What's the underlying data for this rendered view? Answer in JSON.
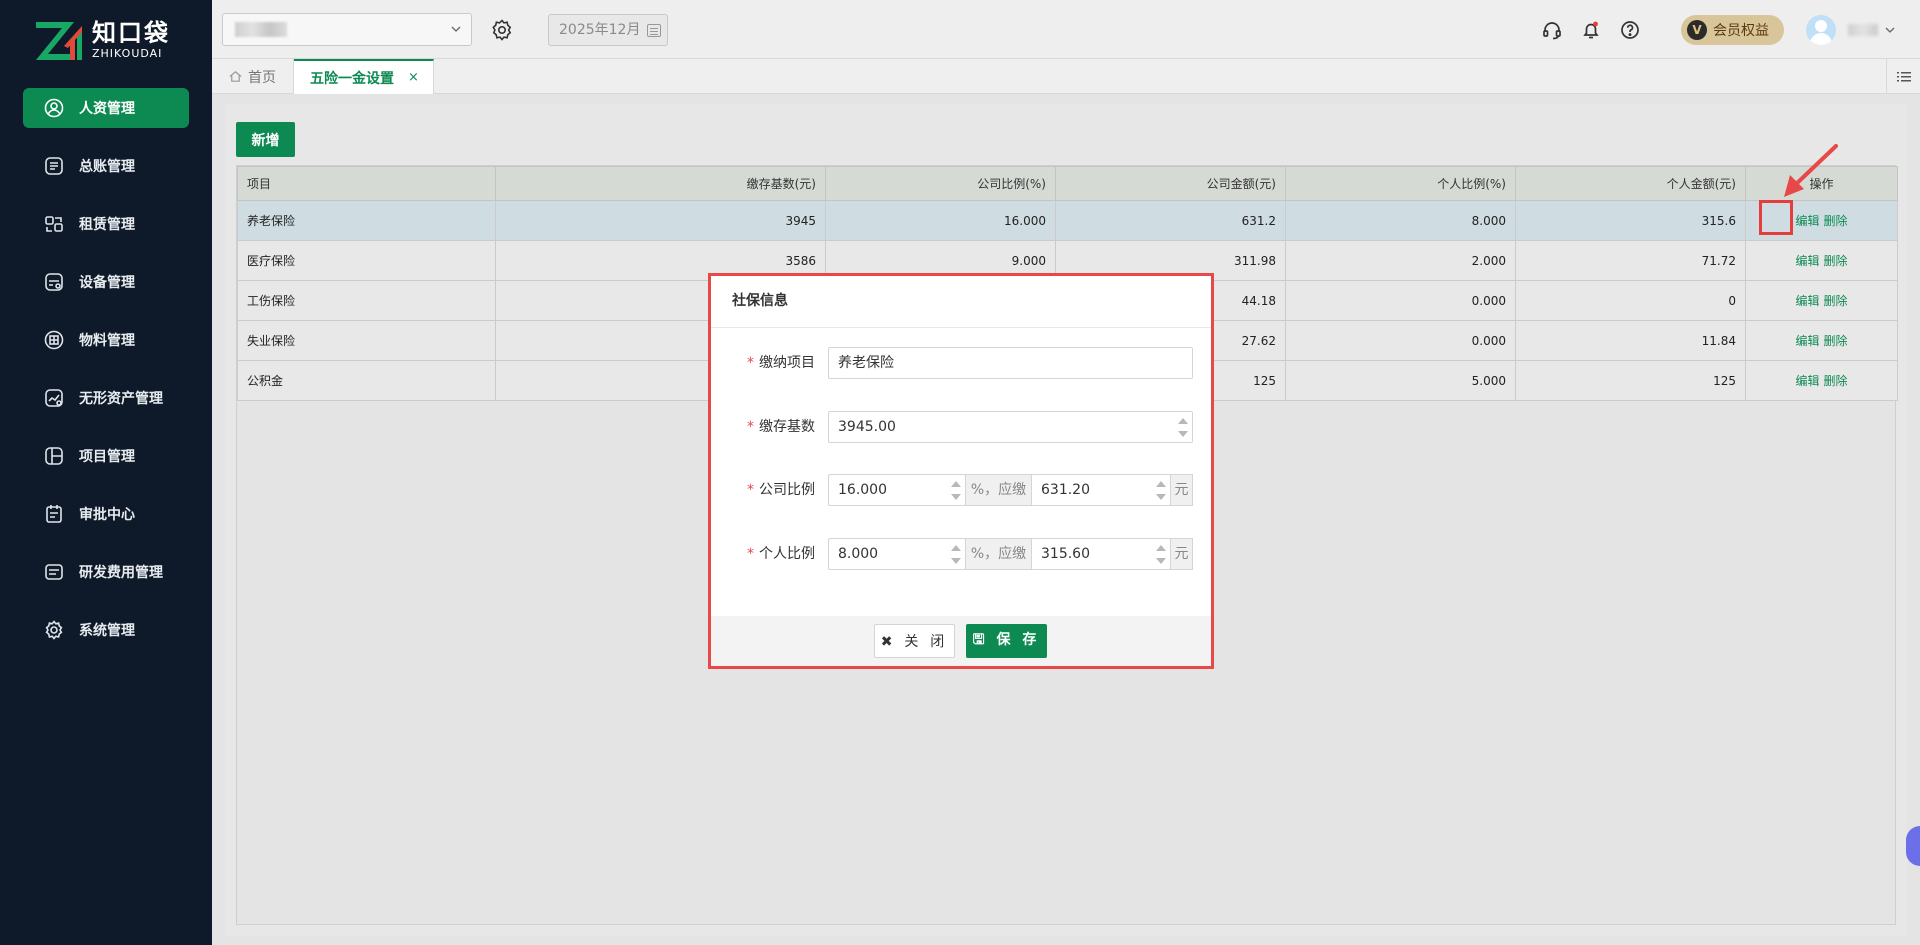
{
  "app": {
    "logo_cn": "知口袋",
    "logo_en": "ZHIKOUDAI",
    "brand_color": "#0c8a52"
  },
  "sidebar": {
    "items": [
      {
        "label": "人资管理",
        "icon": "person-circle-icon",
        "active": true
      },
      {
        "label": "总账管理",
        "icon": "ledger-icon",
        "active": false
      },
      {
        "label": "租赁管理",
        "icon": "lease-icon",
        "active": false
      },
      {
        "label": "设备管理",
        "icon": "equipment-icon",
        "active": false
      },
      {
        "label": "物料管理",
        "icon": "material-icon",
        "active": false
      },
      {
        "label": "无形资产管理",
        "icon": "intangible-asset-icon",
        "active": false
      },
      {
        "label": "项目管理",
        "icon": "project-icon",
        "active": false
      },
      {
        "label": "审批中心",
        "icon": "approval-icon",
        "active": false
      },
      {
        "label": "研发费用管理",
        "icon": "rd-expense-icon",
        "active": false
      },
      {
        "label": "系统管理",
        "icon": "gear-icon",
        "active": false
      }
    ]
  },
  "topbar": {
    "month": "2025年12月",
    "member_label": "会员权益",
    "member_badge": "V"
  },
  "tabs": {
    "home": "首页",
    "active": "五险一金设置",
    "close": "×"
  },
  "toolbar": {
    "add_label": "新增"
  },
  "table": {
    "columns": [
      "项目",
      "缴存基数(元)",
      "公司比例(%)",
      "公司金额(元)",
      "个人比例(%)",
      "个人金额(元)",
      "操作"
    ],
    "rows": [
      {
        "item": "养老保险",
        "base": "3945",
        "company_rate": "16.000",
        "company_amount": "631.2",
        "personal_rate": "8.000",
        "personal_amount": "315.6"
      },
      {
        "item": "医疗保险",
        "base": "3586",
        "company_rate": "9.000",
        "company_amount": "311.98",
        "personal_rate": "2.000",
        "personal_amount": "71.72"
      },
      {
        "item": "工伤保险",
        "base": "",
        "company_rate": "",
        "company_amount": "44.18",
        "personal_rate": "0.000",
        "personal_amount": "0"
      },
      {
        "item": "失业保险",
        "base": "",
        "company_rate": "",
        "company_amount": "27.62",
        "personal_rate": "0.000",
        "personal_amount": "11.84"
      },
      {
        "item": "公积金",
        "base": "",
        "company_rate": "",
        "company_amount": "125",
        "personal_rate": "5.000",
        "personal_amount": "125"
      }
    ],
    "edit_label": "编辑",
    "delete_label": "删除"
  },
  "dialog": {
    "title": "社保信息",
    "fields": {
      "item_label": "缴纳项目",
      "item_value": "养老保险",
      "base_label": "缴存基数",
      "base_value": "3945.00",
      "company_label": "公司比例",
      "company_rate": "16.000",
      "company_amount": "631.20",
      "personal_label": "个人比例",
      "personal_rate": "8.000",
      "personal_amount": "315.60",
      "rate_suffix": "%，应缴",
      "currency_suffix": "元",
      "required_mark": "*"
    },
    "close_label": "关 闭",
    "save_label": "保 存"
  },
  "colors": {
    "sidebar_bg": "#0e1a29",
    "accent": "#0c8a52",
    "annotation_red": "#e84848",
    "member_gold": "#d9c59a"
  }
}
